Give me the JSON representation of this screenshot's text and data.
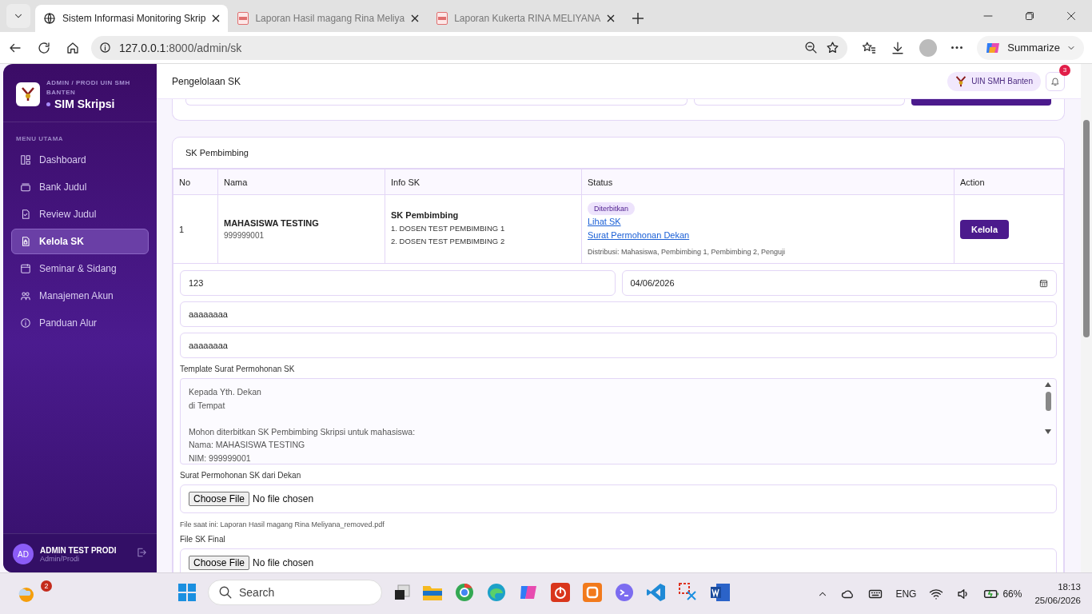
{
  "browser": {
    "tabs": [
      {
        "title": "Sistem Informasi Monitoring Skrip",
        "selected": true
      },
      {
        "title": "Laporan Hasil magang Rina Meliya",
        "selected": false
      },
      {
        "title": "Laporan Kukerta RINA MELIYANA",
        "selected": false
      }
    ],
    "address": {
      "host": "127.0.0.1",
      "rest": ":8000/admin/sk"
    },
    "summarize": "Summarize"
  },
  "sidebar": {
    "org": "ADMIN / PRODI UIN SMH BANTEN",
    "app": "SIM Skripsi",
    "section": "MENU UTAMA",
    "items": [
      {
        "label": "Dashboard",
        "selected": false
      },
      {
        "label": "Bank Judul",
        "selected": false
      },
      {
        "label": "Review Judul",
        "selected": false
      },
      {
        "label": "Kelola SK",
        "selected": true
      },
      {
        "label": "Seminar & Sidang",
        "selected": false
      },
      {
        "label": "Manajemen Akun",
        "selected": false
      },
      {
        "label": "Panduan Alur",
        "selected": false
      }
    ],
    "user": {
      "initials": "AD",
      "name": "ADMIN TEST PRODI",
      "role": "Admin/Prodi"
    }
  },
  "header": {
    "title": "Pengelolaan SK",
    "org_badge": "UIN SMH Banten",
    "notifications": "3"
  },
  "card": {
    "title": "SK Pembimbing",
    "table": {
      "columns": [
        "No",
        "Nama",
        "Info SK",
        "Status",
        "Action"
      ],
      "rows": [
        {
          "no": "1",
          "name": "MAHASISWA TESTING",
          "nim": "999999001",
          "sk_type": "SK Pembimbing",
          "lines": [
            "1. DOSEN TEST PEMBIMBING 1",
            "2. DOSEN TEST PEMBIMBING 2"
          ],
          "status_badge": "Diterbitkan",
          "links": [
            "Lihat SK",
            "Surat Permohonan Dekan"
          ],
          "distribution": "Distribusi: Mahasiswa, Pembimbing 1, Pembimbing 2, Penguji",
          "action": "Kelola"
        }
      ]
    },
    "form": {
      "nomor": "123",
      "tanggal": "04/06/2026",
      "field_3": "aaaaaaaa",
      "field_4": "aaaaaaaa",
      "template_label": "Template Surat Permohonan SK",
      "template_paragraphs": [
        [
          "Kepada Yth. Dekan",
          "di Tempat"
        ],
        [
          "Mohon diterbitkan SK Pembimbing Skripsi untuk mahasiswa:",
          "Nama: MAHASISWA TESTING",
          "NIM: 999999001"
        ]
      ],
      "files": [
        {
          "label": "Surat Permohonan SK dari Dekan",
          "button": "Choose File",
          "status": "No file chosen",
          "note": "File saat ini: Laporan Hasil magang Rina Meliyana_removed.pdf"
        },
        {
          "label": "File SK Final",
          "button": "Choose File",
          "status": "No file chosen"
        }
      ]
    }
  },
  "taskbar": {
    "weather_badge": "2",
    "search": "Search",
    "tray": {
      "language": "ENG",
      "battery": "66%",
      "time": "18:13",
      "date": "25/06/2026"
    }
  }
}
